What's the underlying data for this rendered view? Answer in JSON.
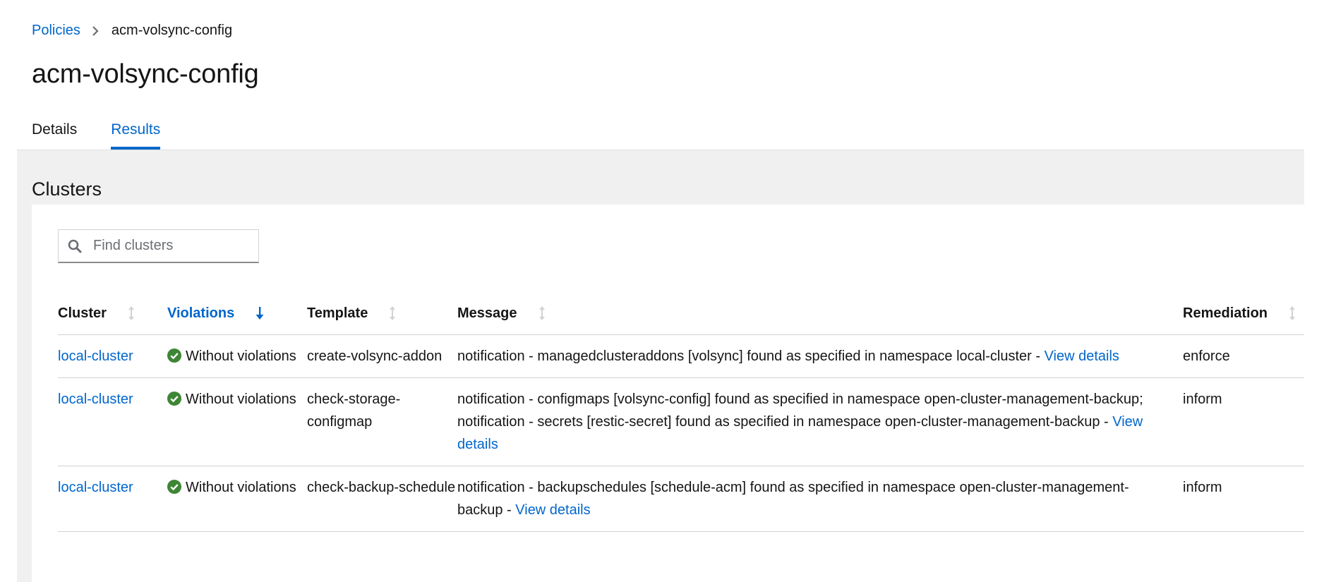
{
  "breadcrumb": {
    "parent": "Policies",
    "current": "acm-volsync-config"
  },
  "page_title": "acm-volsync-config",
  "tabs": [
    {
      "label": "Details",
      "active": false
    },
    {
      "label": "Results",
      "active": true
    }
  ],
  "section_title": "Clusters",
  "search": {
    "placeholder": "Find clusters",
    "value": ""
  },
  "table": {
    "columns": [
      "Cluster",
      "Violations",
      "Template",
      "Message",
      "Remediation"
    ],
    "sorted_column": "Violations",
    "rows": [
      {
        "cluster": "local-cluster",
        "violations": "Without violations",
        "template": "create-volsync-addon",
        "message": "notification - managedclusteraddons [volsync] found as specified in namespace local-cluster - ",
        "message_link": "View details",
        "remediation": "enforce"
      },
      {
        "cluster": "local-cluster",
        "violations": "Without violations",
        "template": "check-storage-configmap",
        "message": "notification - configmaps [volsync-config] found as specified in namespace open-cluster-management-backup; notification - secrets [restic-secret] found as specified in namespace open-cluster-management-backup - ",
        "message_link": "View details",
        "remediation": "inform"
      },
      {
        "cluster": "local-cluster",
        "violations": "Without violations",
        "template": "check-backup-schedule",
        "message": "notification - backupschedules [schedule-acm] found as specified in namespace open-cluster-management-backup - ",
        "message_link": "View details",
        "remediation": "inform"
      }
    ]
  },
  "colors": {
    "link": "#0066cc",
    "success": "#3e8635",
    "text": "#151515",
    "background": "#f0f0f0"
  },
  "icons": {
    "search": "search-icon",
    "sort": "sort-icon",
    "sorted_desc": "arrow-down-icon",
    "status": "check-circle-icon",
    "breadcrumb_sep": "chevron-right-icon"
  }
}
